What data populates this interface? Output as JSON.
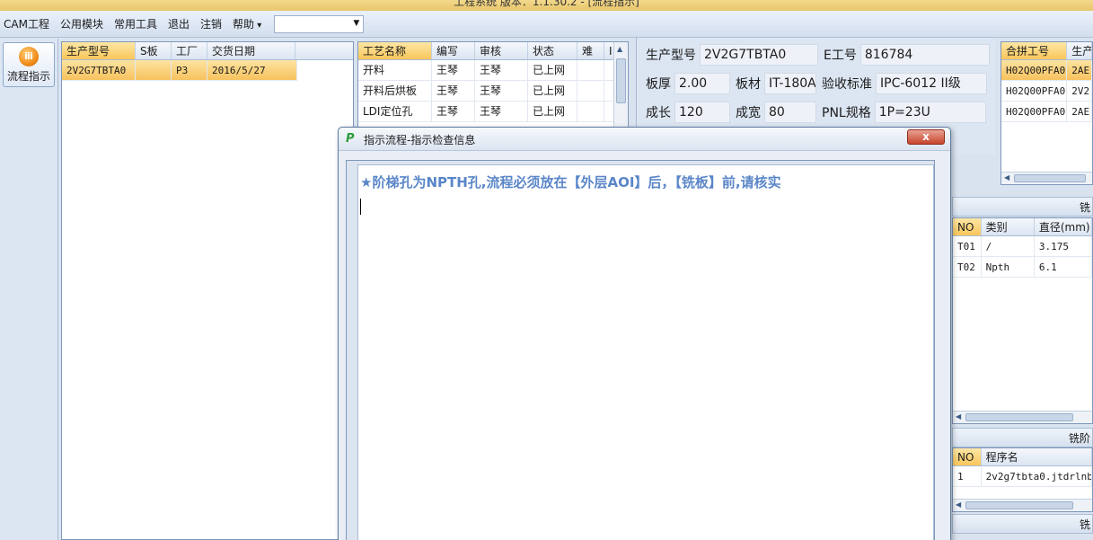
{
  "window": {
    "title": "工程系统   版本：1.1.30.2 - [流程指示]"
  },
  "menubar": {
    "items": [
      "CAM工程",
      "公用模块",
      "常用工具",
      "退出",
      "注销",
      "帮助"
    ],
    "combo_value": ""
  },
  "leftnav": {
    "flow_button": "流程指示"
  },
  "orders": {
    "headers": [
      "生产型号",
      "S板",
      "工厂",
      "交货日期"
    ],
    "rows": [
      [
        "2V2G7TBTA0",
        "",
        "P3",
        "2016/5/27"
      ]
    ]
  },
  "process": {
    "headers": [
      "工艺名称",
      "编写",
      "审核",
      "状态",
      "难",
      "I"
    ],
    "rows": [
      [
        "开料",
        "王琴",
        "王琴",
        "已上网",
        ""
      ],
      [
        "开料后烘板",
        "王琴",
        "王琴",
        "已上网",
        ""
      ],
      [
        "LDI定位孔",
        "王琴",
        "王琴",
        "已上网",
        ""
      ]
    ]
  },
  "info": {
    "model_label": "生产型号",
    "model_value": "2V2G7TBTA0",
    "e_label": "E工号",
    "e_value": "816784",
    "thick_label": "板厚",
    "thick_value": "2.00",
    "material_label": "板材",
    "material_value": "IT-180A",
    "standard_label": "验收标准",
    "standard_value": "IPC-6012 II级",
    "length_label": "成长",
    "length_value": "120",
    "width_label": "成宽",
    "width_value": "80",
    "pnl_label": "PNL规格",
    "pnl_value": "1P=23U"
  },
  "joint": {
    "headers": [
      "合拼工号",
      "生产"
    ],
    "rows": [
      [
        "H02Q00PFA0",
        "2AE"
      ],
      [
        "H02Q00PFA0",
        "2V2"
      ],
      [
        "H02Q00PFA0",
        "2AE"
      ]
    ]
  },
  "drill": {
    "section_title": "铣",
    "headers": [
      "NO",
      "类别",
      "直径(mm)"
    ],
    "rows": [
      [
        "T01",
        "/",
        "3.175"
      ],
      [
        "T02",
        "Npth",
        "6.1"
      ]
    ]
  },
  "mill": {
    "section_title": "铣阶",
    "headers": [
      "NO",
      "程序名"
    ],
    "rows": [
      [
        "1",
        "2v2g7tbta0.jtdrlnb"
      ]
    ]
  },
  "bottom": {
    "section_title": "铣"
  },
  "dialog": {
    "title": "指示流程-指示检查信息",
    "close_label": "x",
    "message": "★阶梯孔为NPTH孔,流程必须放在【外层AOI】后，【铣板】前,请核实"
  },
  "colors": {
    "accent": "#5a86c8",
    "selection": "#f9c65a",
    "close": "#c7452c"
  }
}
